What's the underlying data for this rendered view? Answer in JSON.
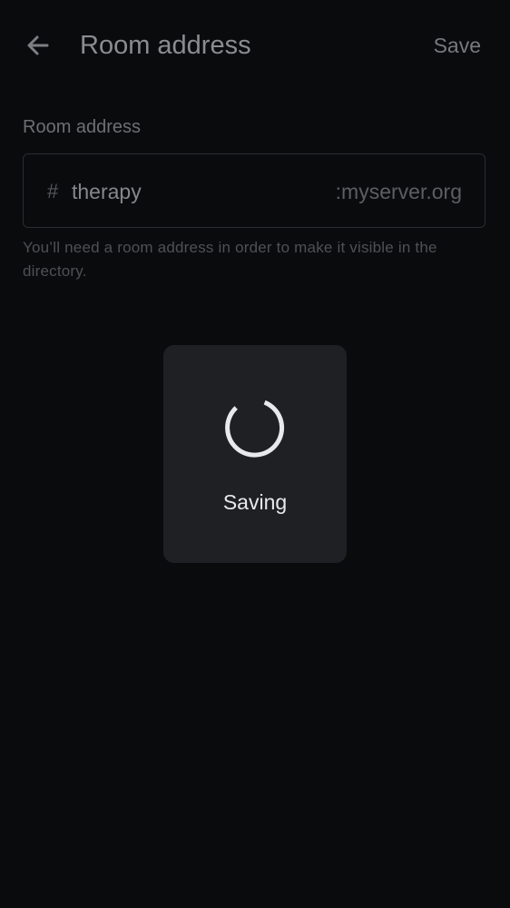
{
  "header": {
    "back_icon": "arrow-left-icon",
    "title": "Room address",
    "save_label": "Save"
  },
  "form": {
    "section_label": "Room address",
    "hash_symbol": "#",
    "address_value": "therapy",
    "address_suffix": ":myserver.org",
    "helper_text": "You’ll need a room address in order to make it visible in the directory."
  },
  "dialog": {
    "spinner_icon": "loading-spinner-icon",
    "message": "Saving"
  },
  "colors": {
    "background": "#0a0b0d",
    "dialog_background": "#1f2024",
    "dialog_text": "#e8e9eb"
  }
}
